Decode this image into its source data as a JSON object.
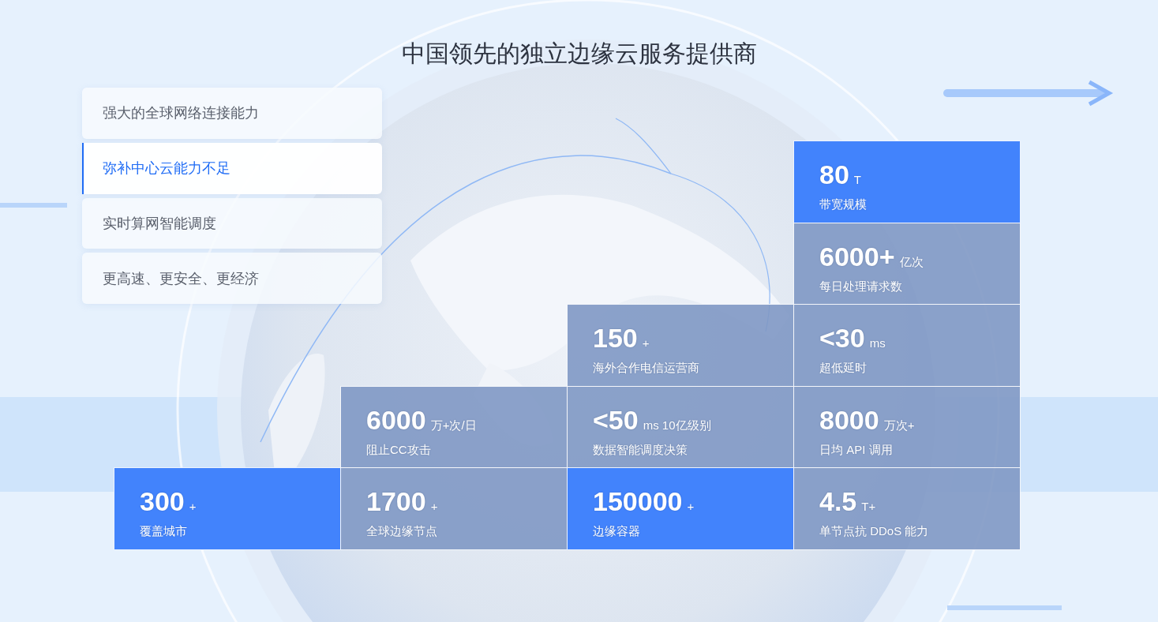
{
  "title": "中国领先的独立边缘云服务提供商",
  "tabs": [
    {
      "label": "强大的全球网络连接能力",
      "selected": false
    },
    {
      "label": "弥补中心云能力不足",
      "selected": true
    },
    {
      "label": "实时算网智能调度",
      "selected": false
    },
    {
      "label": "更高速、更安全、更经济",
      "selected": false
    }
  ],
  "stat_rows": [
    [
      {
        "value": "80",
        "unit": "T",
        "label": "带宽规模",
        "highlighted": true
      }
    ],
    [
      {
        "value": "6000+",
        "unit": "亿次",
        "label": "每日处理请求数",
        "highlighted": false
      }
    ],
    [
      {
        "value": "150",
        "unit": "+",
        "label": "海外合作电信运营商",
        "highlighted": false
      },
      {
        "value": "<30",
        "unit": "ms",
        "label": "超低延时",
        "highlighted": false
      }
    ],
    [
      {
        "value": "6000",
        "unit": "万+次/日",
        "label": "阻止CC攻击",
        "highlighted": false
      },
      {
        "value": "<50",
        "unit": "ms 10亿级别",
        "label": "数据智能调度决策",
        "highlighted": false
      },
      {
        "value": "8000",
        "unit": "万次+",
        "label": "日均 API 调用",
        "highlighted": false
      }
    ],
    [
      {
        "value": "300",
        "unit": "+",
        "label": "覆盖城市",
        "highlighted": true
      },
      {
        "value": "1700",
        "unit": "+",
        "label": "全球边缘节点",
        "highlighted": false
      },
      {
        "value": "150000",
        "unit": "+",
        "label": "边缘容器",
        "highlighted": true
      },
      {
        "value": "4.5",
        "unit": "T+",
        "label": "单节点抗 DDoS 能力",
        "highlighted": false
      }
    ]
  ]
}
